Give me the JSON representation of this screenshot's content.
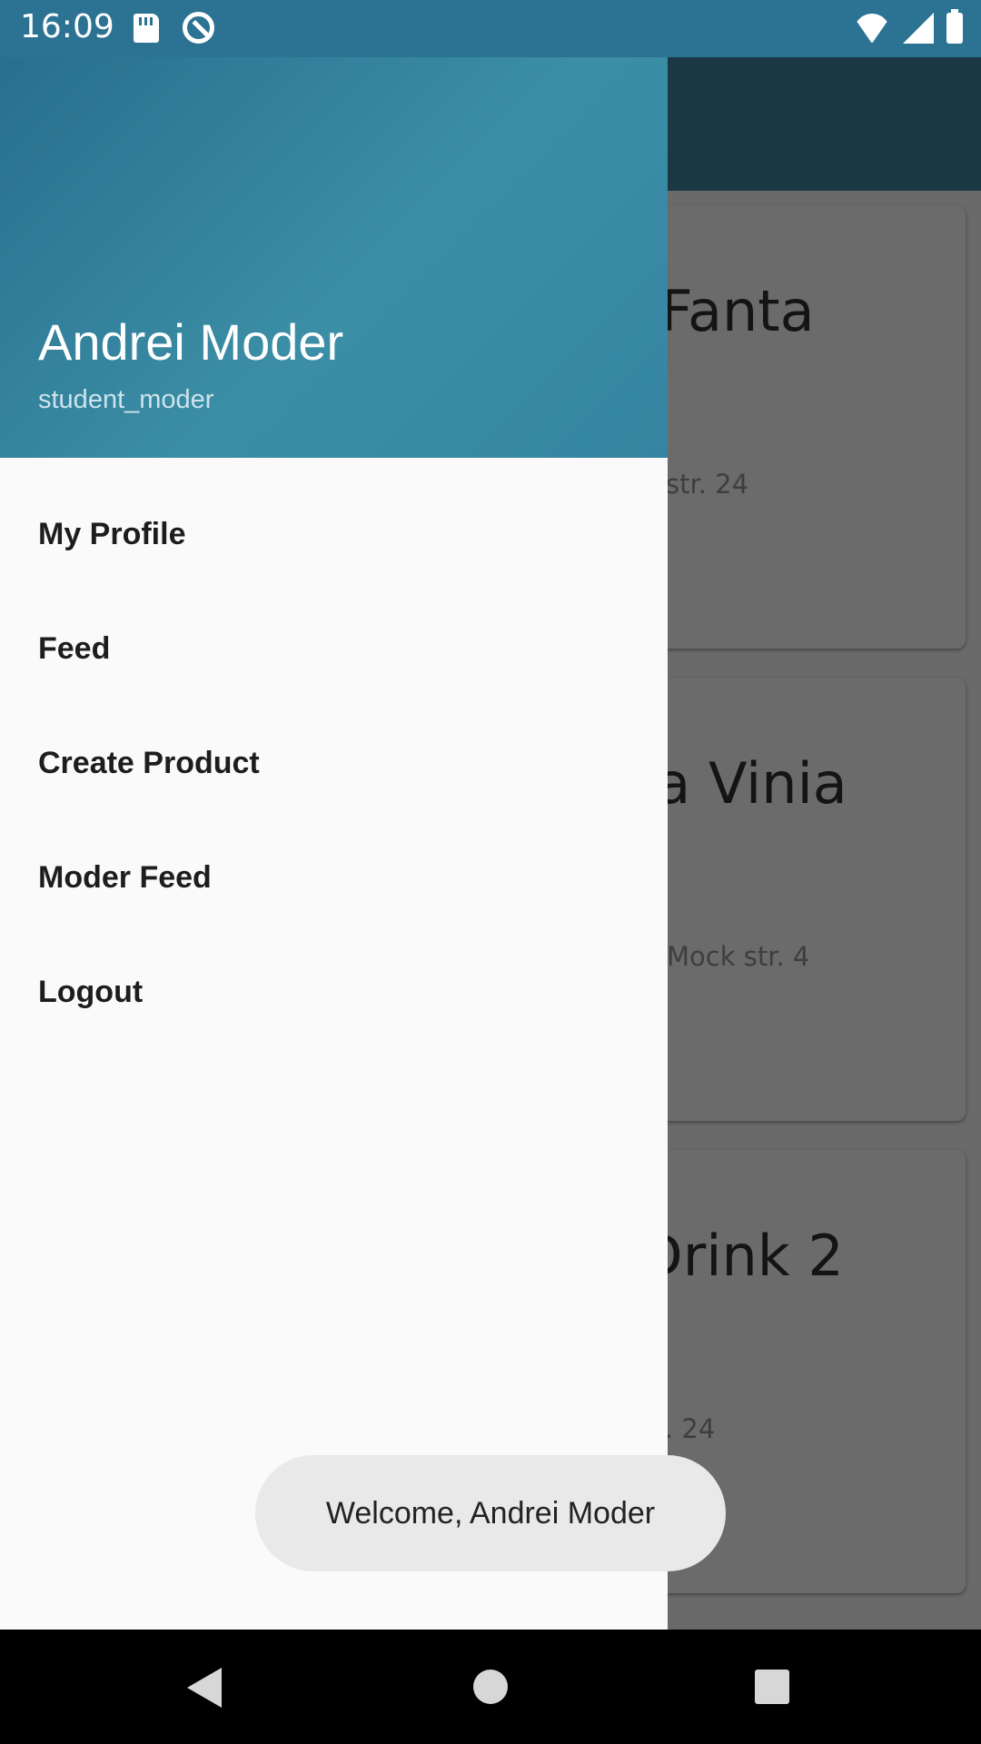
{
  "status_bar": {
    "time": "16:09",
    "icons": [
      "sd-card-icon",
      "sync-icon",
      "wifi-icon",
      "signal-icon",
      "battery-icon"
    ],
    "background": "#2c7393"
  },
  "background_feed": {
    "cards": [
      {
        "name": "Fanta",
        "address": "str. 24"
      },
      {
        "name": "ta Vinia",
        "address": "Mock str. 4"
      },
      {
        "name": "Drink 2",
        "address": ". 24"
      }
    ]
  },
  "drawer": {
    "header": {
      "name": "Andrei Moder",
      "username": "student_moder"
    },
    "menu": [
      {
        "label": "My Profile"
      },
      {
        "label": "Feed"
      },
      {
        "label": "Create Product"
      },
      {
        "label": "Moder Feed"
      },
      {
        "label": "Logout"
      }
    ]
  },
  "toast": {
    "message": "Welcome, Andrei Moder"
  },
  "nav_bar": {
    "icons": [
      "back-icon",
      "home-icon",
      "recents-icon"
    ]
  },
  "colors": {
    "accent": "#3585a2",
    "drawer_bg": "#fafafa"
  }
}
